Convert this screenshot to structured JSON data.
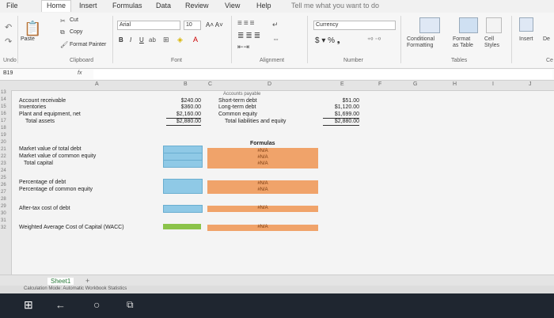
{
  "tabs": [
    "File",
    "Home",
    "Insert",
    "Formulas",
    "Data",
    "Review",
    "View",
    "Help"
  ],
  "tell_me": "Tell me what you want to do",
  "clipboard": {
    "cut": "Cut",
    "copy": "Copy",
    "paste": "Paste",
    "format_painter": "Format Painter",
    "group": "Clipboard"
  },
  "font": {
    "name": "Arial",
    "size": "10",
    "group": "Font"
  },
  "alignment": {
    "group": "Alignment"
  },
  "number": {
    "format": "Currency",
    "group": "Number"
  },
  "styles": {
    "conditional": "Conditional\nFormatting",
    "format_table": "Format\nas Table",
    "cell_styles": "Cell\nStyles",
    "group": "Tables"
  },
  "cells": {
    "insert": "Insert",
    "delete": "De",
    "group": "Ce"
  },
  "undo_label": "Undo",
  "name_box": "B19",
  "fx": "fx",
  "columns": [
    "A",
    "B",
    "C",
    "D",
    "E",
    "F",
    "G",
    "H",
    "I",
    "J"
  ],
  "rows": [
    "13",
    "14",
    "15",
    "16",
    "17",
    "18",
    "19",
    "20",
    "21",
    "22",
    "23",
    "24",
    "25",
    "26",
    "27",
    "28",
    "29",
    "30",
    "31",
    "32"
  ],
  "assets": [
    {
      "label": "Account receivable",
      "value": "$240.00"
    },
    {
      "label": "Inventories",
      "value": "$360.00"
    },
    {
      "label": "Plant and equipment, net",
      "value": "$2,160.00"
    },
    {
      "label": "Total assets",
      "value": "$2,880.00"
    }
  ],
  "liabilities_header": "Accounts payable",
  "liabilities": [
    {
      "label": "Short-term debt",
      "value": "$51.00"
    },
    {
      "label": "Long-term debt",
      "value": "$1,120.00"
    },
    {
      "label": "Common equity",
      "value": "$1,699.00"
    },
    {
      "label": "Total liabilities and equity",
      "value": "$2,880.00"
    }
  ],
  "inputs": [
    "Market value of total debt",
    "Market value of common equity",
    "Total capital",
    "Percentage of debt",
    "Percentage of common equity",
    "After-tax cost of debt",
    "Weighted Average Cost of Capital (WACC)"
  ],
  "formulas_header": "Formulas",
  "na": "#N/A",
  "sheet_tab": "Sheet1",
  "status_text": "Calculation Mode: Automatic    Workbook Statistics",
  "colors": {
    "blue": "#8fc9e6",
    "green": "#8bc34a",
    "orange": "#f0a36a"
  }
}
